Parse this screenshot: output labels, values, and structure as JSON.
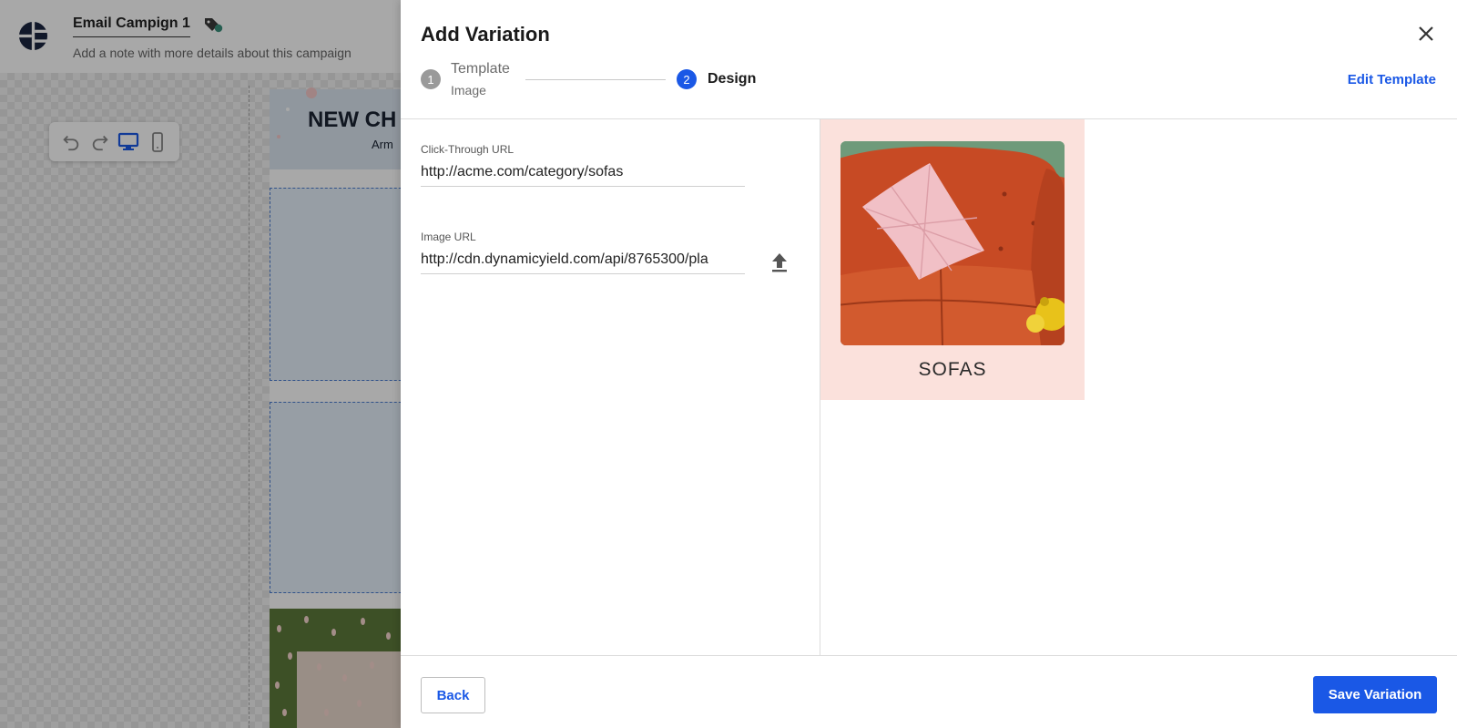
{
  "app": {
    "campaign_name": "Email Campign 1",
    "campaign_note": "Add a note with more details about this campaign",
    "email_preview": {
      "hero_title": "NEW CH",
      "hero_subtitle": "Arm"
    }
  },
  "modal": {
    "title": "Add Variation",
    "steps": [
      {
        "number": "1",
        "label": "Template",
        "sublabel": "Image",
        "status": "completed"
      },
      {
        "number": "2",
        "label": "Design",
        "status": "active"
      }
    ],
    "edit_template_label": "Edit Template",
    "fields": {
      "click_through": {
        "label": "Click-Through URL",
        "value": "http://acme.com/category/sofas"
      },
      "image_url": {
        "label": "Image URL",
        "value": "http://cdn.dynamicyield.com/api/8765300/pla"
      }
    },
    "preview": {
      "caption": "SOFAS",
      "background_color": "#fbe1dc"
    },
    "back_label": "Back",
    "save_label": "Save Variation"
  },
  "colors": {
    "accent": "#1a58e6",
    "step_inactive": "#9a9a9a"
  },
  "icons": [
    "logo-icon",
    "tag-icon",
    "undo-icon",
    "redo-icon",
    "desktop-icon",
    "mobile-icon",
    "close-icon",
    "upload-icon"
  ]
}
